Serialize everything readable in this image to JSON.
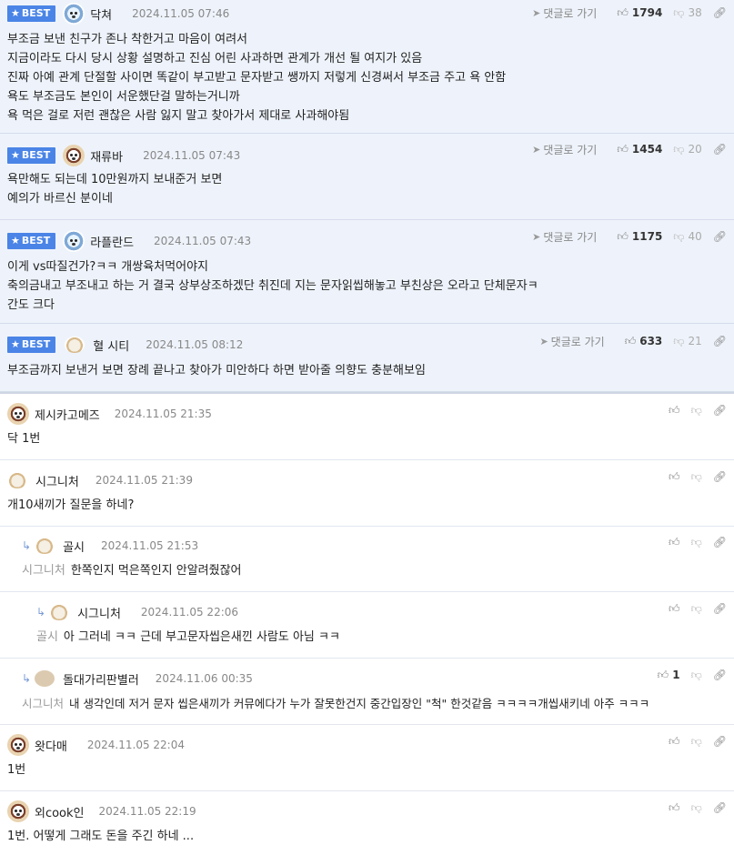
{
  "labels": {
    "best": "BEST",
    "reply": "댓글로 가기"
  },
  "best": [
    {
      "nick": "닥쳐",
      "date": "2024.11.05 07:46",
      "up": "1794",
      "down": "38",
      "lines": [
        "부조금 보낸 친구가 존나 착한거고 마음이 여려서",
        "지금이라도 다시 당시 상황 설명하고 진심 어린 사과하면 관계가 개선 될 여지가 있음",
        "진짜 아예 관계 단절할 사이면 똑같이 부고받고 문자받고 쌩까지 저렇게 신경써서 부조금 주고 욕 안함",
        "욕도 부조금도 본인이 서운했단걸 말하는거니까",
        "욕 먹은 걸로 저런 괜찮은 사람 잃지 말고 찾아가서 제대로 사과해야됨"
      ]
    },
    {
      "nick": "재류바",
      "date": "2024.11.05 07:43",
      "up": "1454",
      "down": "20",
      "lines": [
        "욕만해도 되는데 10만원까지 보내준거 보면",
        "예의가 바르신 분이네"
      ]
    },
    {
      "nick": "라플란드",
      "date": "2024.11.05 07:43",
      "up": "1175",
      "down": "40",
      "lines": [
        "이게 vs따질건가?ㅋㅋ 개쌍육처먹어야지",
        "축의금내고 부조내고 하는 거 결국 상부상조하겠단 취진데 지는 문자읽씹해놓고 부친상은 오라고 단체문자ㅋ",
        "간도 크다"
      ]
    },
    {
      "nick": "혈 시티",
      "date": "2024.11.05 08:12",
      "up": "633",
      "down": "21",
      "lines": [
        "부조금까지 보낸거 보면 장례 끝나고 찾아가 미안하다 하면 받아줄 의향도 충분해보임"
      ]
    }
  ],
  "comments": [
    {
      "nick": "제시카고메즈",
      "date": "2024.11.05 21:35",
      "text": "닥 1번"
    },
    {
      "nick": "시그니처",
      "date": "2024.11.05 21:39",
      "text": "개10새끼가 질문을 하네?"
    },
    {
      "nick": "골시",
      "date": "2024.11.05 21:53",
      "mention": "시그니처",
      "text": "한쪽인지 먹은쪽인지 안알려줬잖어"
    },
    {
      "nick": "시그니처",
      "date": "2024.11.05 22:06",
      "mention": "골시",
      "text": "아 그러네 ㅋㅋ 근데 부고문자씹은새낀 사람도 아님 ㅋㅋ"
    },
    {
      "nick": "돌대가리판별러",
      "date": "2024.11.06 00:35",
      "up": "1",
      "mention": "시그니처",
      "text": "내 생각인데 저거 문자 씹은새끼가 커뮤에다가 누가 잘못한건지 중간입장인 \"척\" 한것같음 ㅋㅋㅋㅋ개씹새키네 아주 ㅋㅋㅋ"
    },
    {
      "nick": "왓다매",
      "date": "2024.11.05 22:04",
      "text": "1번"
    },
    {
      "nick": "외cook인",
      "date": "2024.11.05 22:19",
      "text": "1번. 어떻게 그래도 돈을 주긴 하네 ..."
    }
  ]
}
